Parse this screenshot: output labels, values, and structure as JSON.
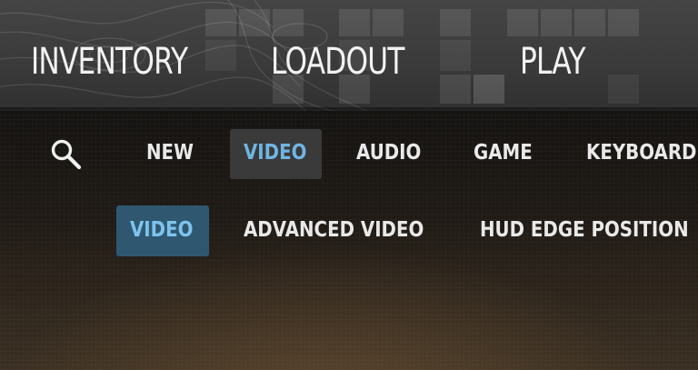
{
  "main_nav": {
    "items": [
      {
        "label": "INVENTORY"
      },
      {
        "label": "LOADOUT"
      },
      {
        "label": "PLAY"
      }
    ]
  },
  "settings_tabs": {
    "items": [
      {
        "label": "NEW",
        "active": false
      },
      {
        "label": "VIDEO",
        "active": true
      },
      {
        "label": "AUDIO",
        "active": false
      },
      {
        "label": "GAME",
        "active": false
      },
      {
        "label": "KEYBOARD",
        "active": false
      }
    ]
  },
  "settings_subtabs": {
    "items": [
      {
        "label": "VIDEO",
        "active": true
      },
      {
        "label": "ADVANCED VIDEO",
        "active": false
      },
      {
        "label": "HUD EDGE POSITION",
        "active": false
      }
    ]
  },
  "icons": {
    "search": "search-icon"
  },
  "colors": {
    "active_tab_text": "#6fb5e3",
    "active_subtab_bg": "#2f5870",
    "active_subtab_text": "#7ec3ee"
  }
}
